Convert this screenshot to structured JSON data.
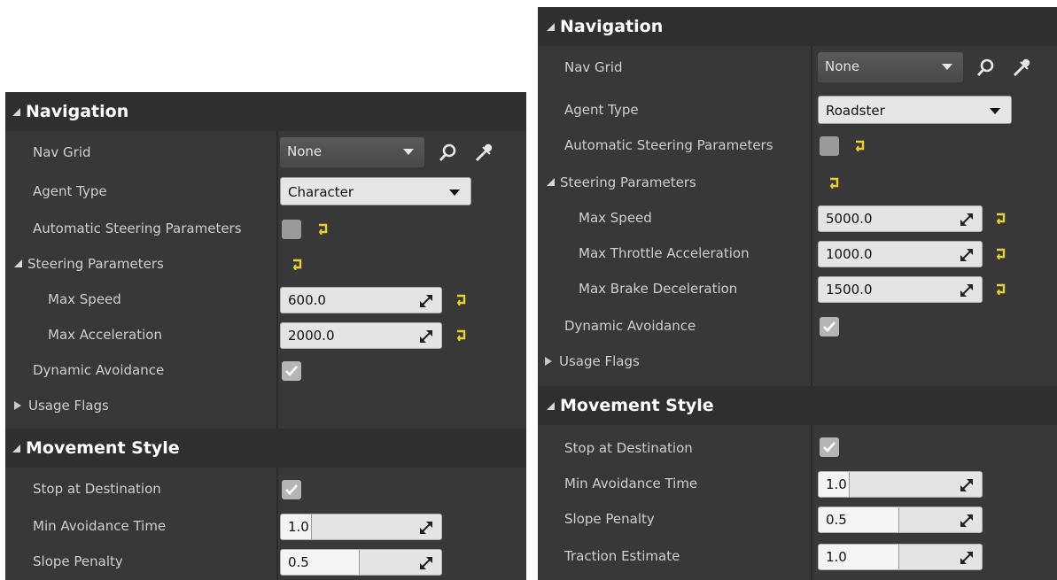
{
  "left": {
    "navigation_header": "Navigation",
    "nav_grid_label": "Nav Grid",
    "nav_grid_value": "None",
    "agent_type_label": "Agent Type",
    "agent_type_value": "Character",
    "auto_steering_label": "Automatic Steering Parameters",
    "steering_params_label": "Steering Parameters",
    "max_speed_label": "Max Speed",
    "max_speed_value": "600.0",
    "max_accel_label": "Max Acceleration",
    "max_accel_value": "2000.0",
    "dynamic_avoidance_label": "Dynamic Avoidance",
    "usage_flags_label": "Usage Flags",
    "movement_style_header": "Movement Style",
    "stop_at_destination_label": "Stop at Destination",
    "min_avoidance_time_label": "Min Avoidance Time",
    "min_avoidance_time_value": "1.0",
    "slope_penalty_label": "Slope Penalty",
    "slope_penalty_value": "0.5"
  },
  "right": {
    "navigation_header": "Navigation",
    "nav_grid_label": "Nav Grid",
    "nav_grid_value": "None",
    "agent_type_label": "Agent Type",
    "agent_type_value": "Roadster",
    "auto_steering_label": "Automatic Steering Parameters",
    "steering_params_label": "Steering Parameters",
    "max_speed_label": "Max Speed",
    "max_speed_value": "5000.0",
    "max_throttle_label": "Max Throttle Acceleration",
    "max_throttle_value": "1000.0",
    "max_brake_label": "Max Brake Deceleration",
    "max_brake_value": "1500.0",
    "dynamic_avoidance_label": "Dynamic Avoidance",
    "usage_flags_label": "Usage Flags",
    "movement_style_header": "Movement Style",
    "stop_at_destination_label": "Stop at Destination",
    "min_avoidance_time_label": "Min Avoidance Time",
    "min_avoidance_time_value": "1.0",
    "slope_penalty_label": "Slope Penalty",
    "slope_penalty_value": "0.5",
    "traction_estimate_label": "Traction Estimate",
    "traction_estimate_value": "1.0"
  }
}
